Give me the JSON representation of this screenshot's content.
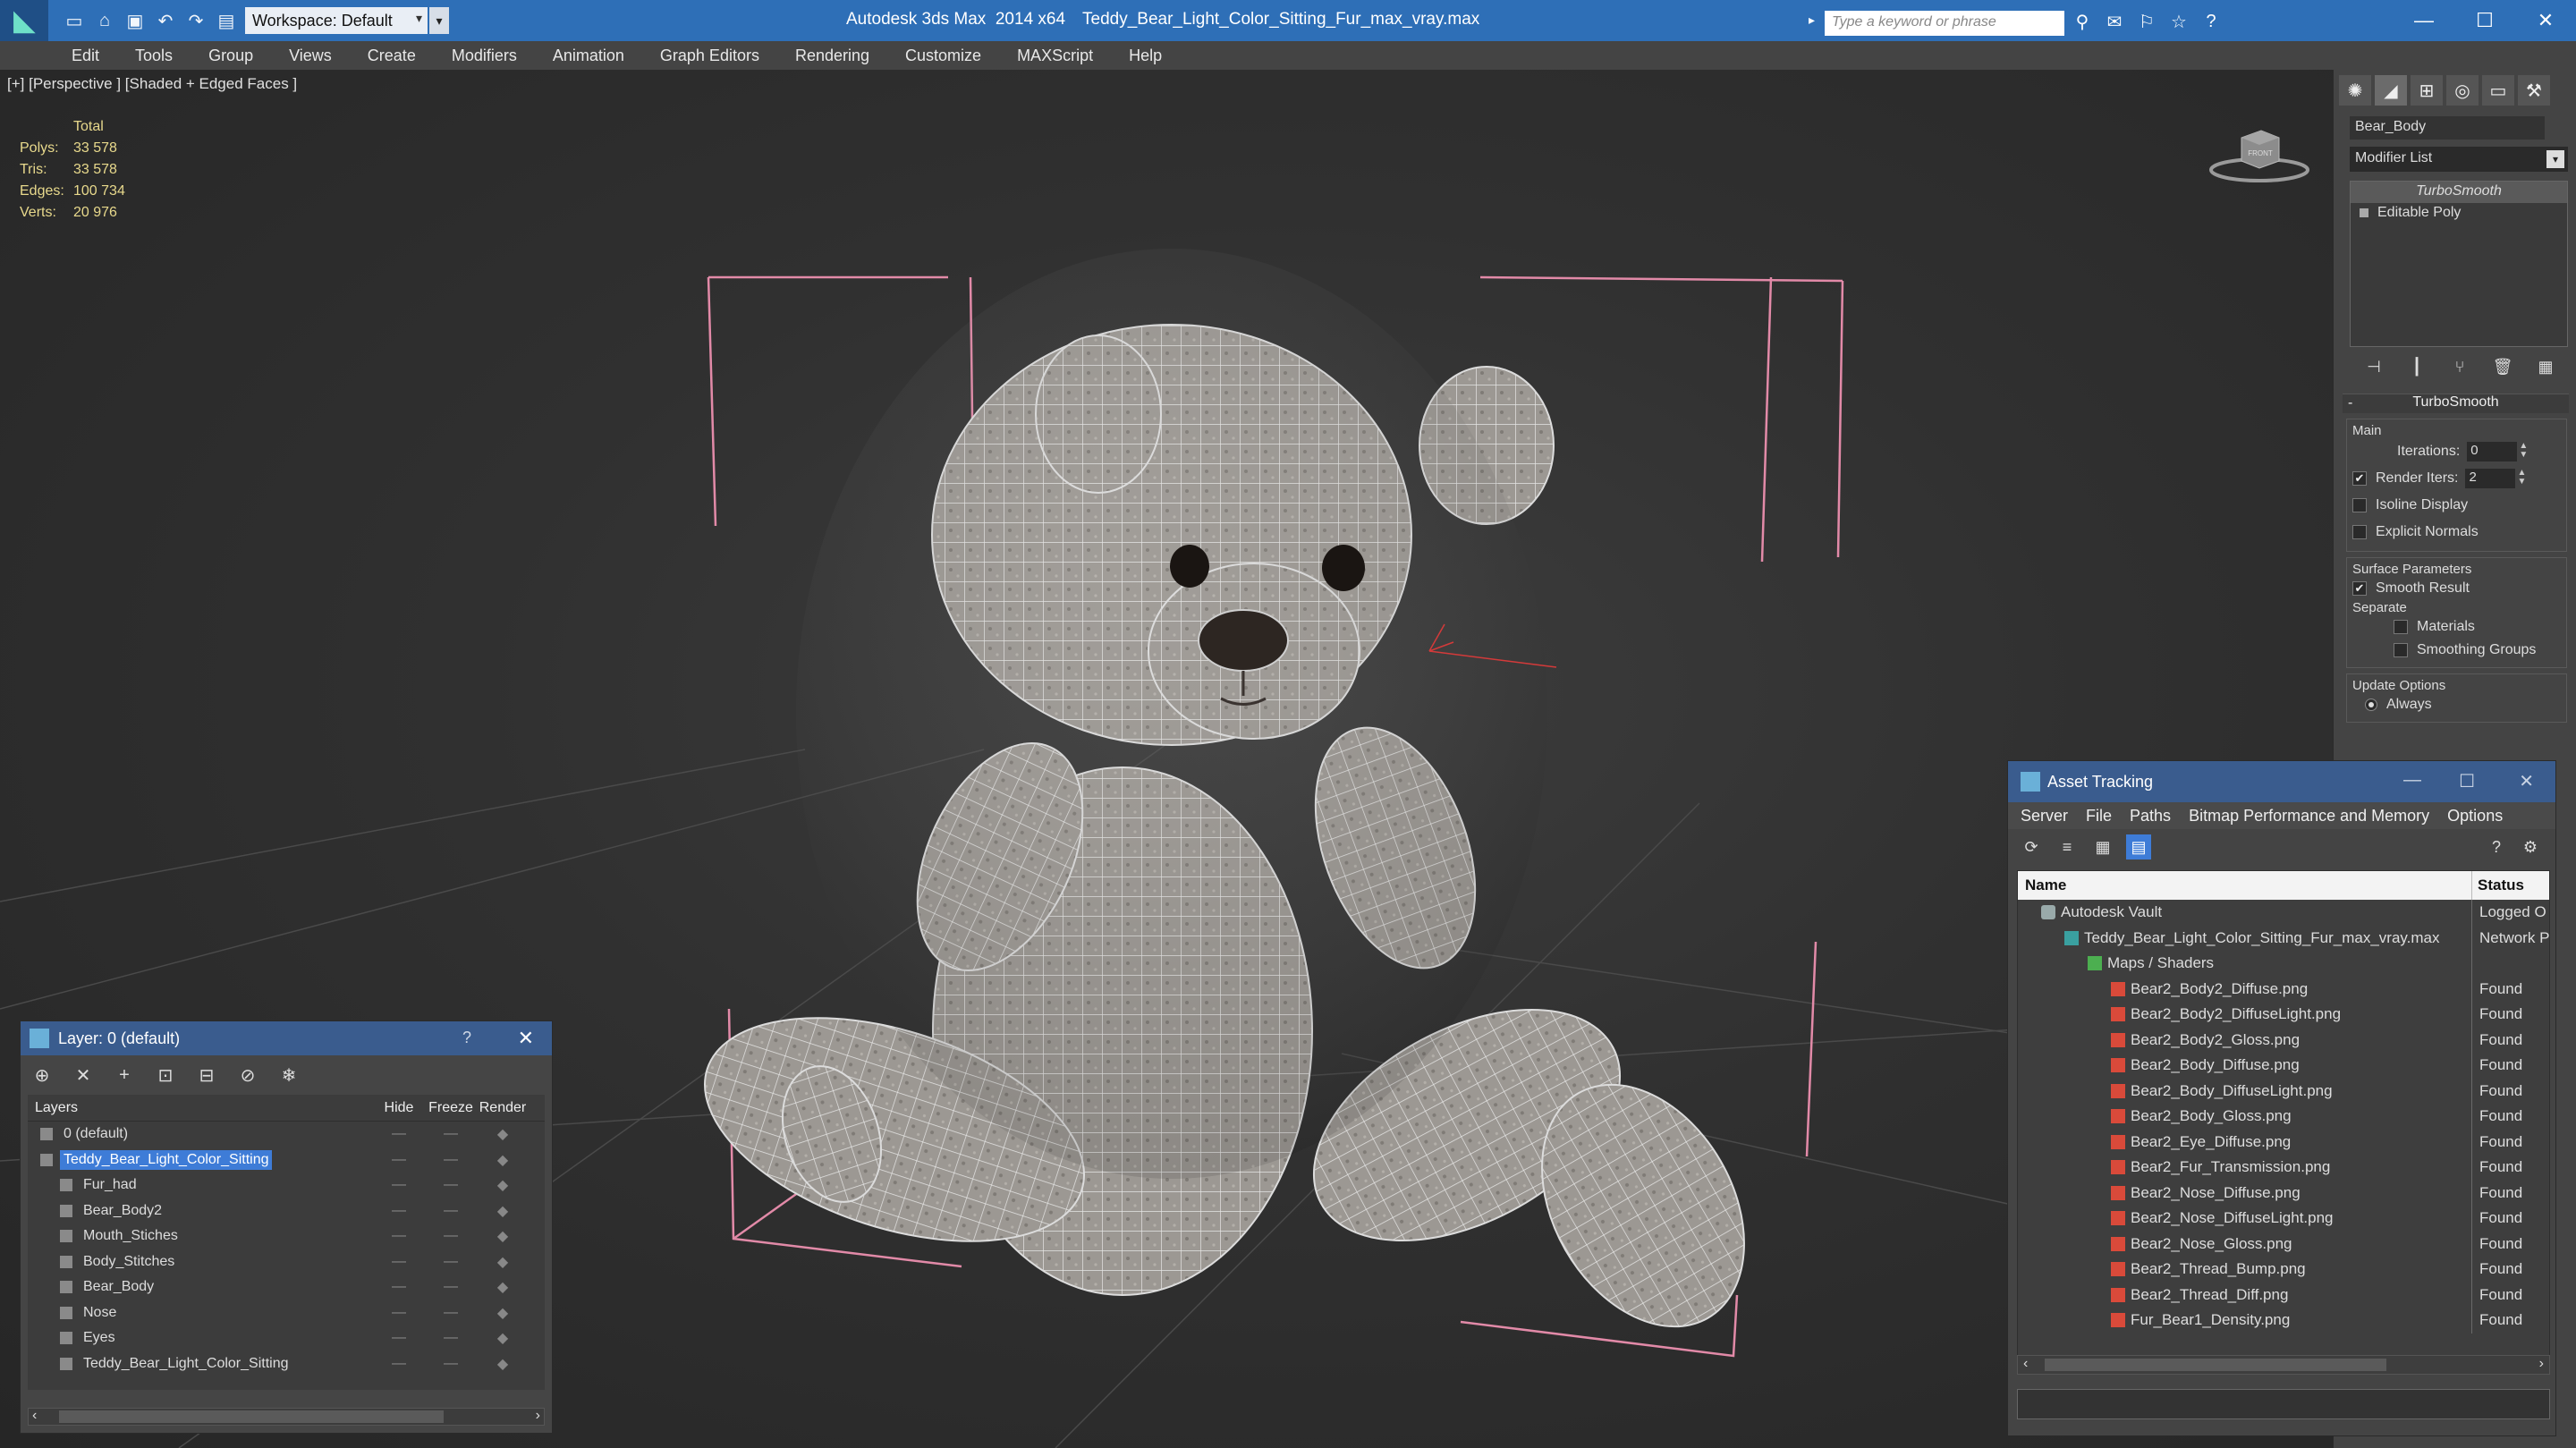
{
  "titlebar": {
    "workspace_label": "Workspace: Default",
    "app_name": "Autodesk 3ds Max  2014 x64",
    "file_name": "Teddy_Bear_Light_Color_Sitting_Fur_max_vray.max",
    "search_placeholder": "Type a keyword or phrase",
    "accent_color": "#2e6fb7"
  },
  "menu": [
    "Edit",
    "Tools",
    "Group",
    "Views",
    "Create",
    "Modifiers",
    "Animation",
    "Graph Editors",
    "Rendering",
    "Customize",
    "MAXScript",
    "Help"
  ],
  "viewport": {
    "label": "[+] [Perspective ] [Shaded + Edged Faces ]",
    "stats": {
      "header": "Total",
      "rows": [
        {
          "k": "Polys:",
          "v": "33 578"
        },
        {
          "k": "Tris:",
          "v": "33 578"
        },
        {
          "k": "Edges:",
          "v": "100 734"
        },
        {
          "k": "Verts:",
          "v": "20 976"
        }
      ]
    },
    "viewcube_label": "FRONT"
  },
  "command_panel": {
    "object_name": "Bear_Body",
    "modifier_list": "Modifier List",
    "stack": [
      "TurboSmooth",
      "Editable Poly"
    ],
    "rollout_title": "TurboSmooth",
    "main_group": "Main",
    "iterations_label": "Iterations:",
    "iterations_value": "0",
    "render_iters_label": "Render Iters:",
    "render_iters_value": "2",
    "isoline_label": "Isoline Display",
    "explicit_normals_label": "Explicit Normals",
    "surface_group": "Surface Parameters",
    "smooth_result_label": "Smooth Result",
    "separate_label": "Separate",
    "materials_label": "Materials",
    "smoothing_groups_label": "Smoothing Groups",
    "update_group": "Update Options",
    "always_label": "Always"
  },
  "layer_panel": {
    "title": "Layer: 0 (default)",
    "columns": [
      "Layers",
      "Hide",
      "Freeze",
      "Render"
    ],
    "rows": [
      {
        "name": "0 (default)",
        "level": 0,
        "selected": false
      },
      {
        "name": "Teddy_Bear_Light_Color_Sitting",
        "level": 0,
        "selected": true
      },
      {
        "name": "Fur_had",
        "level": 1,
        "selected": false
      },
      {
        "name": "Bear_Body2",
        "level": 1,
        "selected": false
      },
      {
        "name": "Mouth_Stiches",
        "level": 1,
        "selected": false
      },
      {
        "name": "Body_Stitches",
        "level": 1,
        "selected": false
      },
      {
        "name": "Bear_Body",
        "level": 1,
        "selected": false
      },
      {
        "name": "Nose",
        "level": 1,
        "selected": false
      },
      {
        "name": "Eyes",
        "level": 1,
        "selected": false
      },
      {
        "name": "Teddy_Bear_Light_Color_Sitting",
        "level": 1,
        "selected": false
      }
    ]
  },
  "asset_panel": {
    "title": "Asset Tracking",
    "menu": [
      "Server",
      "File",
      "Paths",
      "Bitmap Performance and Memory",
      "Options"
    ],
    "columns": [
      "Name",
      "Status"
    ],
    "rows": [
      {
        "name": "Autodesk Vault",
        "status": "Logged O",
        "level": 1,
        "icon": "vault"
      },
      {
        "name": "Teddy_Bear_Light_Color_Sitting_Fur_max_vray.max",
        "status": "Network P",
        "level": 2,
        "icon": "max"
      },
      {
        "name": "Maps / Shaders",
        "status": "",
        "level": 3,
        "icon": "maps"
      },
      {
        "name": "Bear2_Body2_Diffuse.png",
        "status": "Found",
        "level": 4,
        "icon": "png"
      },
      {
        "name": "Bear2_Body2_DiffuseLight.png",
        "status": "Found",
        "level": 4,
        "icon": "png"
      },
      {
        "name": "Bear2_Body2_Gloss.png",
        "status": "Found",
        "level": 4,
        "icon": "png"
      },
      {
        "name": "Bear2_Body_Diffuse.png",
        "status": "Found",
        "level": 4,
        "icon": "png"
      },
      {
        "name": "Bear2_Body_DiffuseLight.png",
        "status": "Found",
        "level": 4,
        "icon": "png"
      },
      {
        "name": "Bear2_Body_Gloss.png",
        "status": "Found",
        "level": 4,
        "icon": "png"
      },
      {
        "name": "Bear2_Eye_Diffuse.png",
        "status": "Found",
        "level": 4,
        "icon": "png"
      },
      {
        "name": "Bear2_Fur_Transmission.png",
        "status": "Found",
        "level": 4,
        "icon": "png"
      },
      {
        "name": "Bear2_Nose_Diffuse.png",
        "status": "Found",
        "level": 4,
        "icon": "png"
      },
      {
        "name": "Bear2_Nose_DiffuseLight.png",
        "status": "Found",
        "level": 4,
        "icon": "png"
      },
      {
        "name": "Bear2_Nose_Gloss.png",
        "status": "Found",
        "level": 4,
        "icon": "png"
      },
      {
        "name": "Bear2_Thread_Bump.png",
        "status": "Found",
        "level": 4,
        "icon": "png"
      },
      {
        "name": "Bear2_Thread_Diff.png",
        "status": "Found",
        "level": 4,
        "icon": "png"
      },
      {
        "name": "Fur_Bear1_Density.png",
        "status": "Found",
        "level": 4,
        "icon": "png"
      }
    ]
  }
}
